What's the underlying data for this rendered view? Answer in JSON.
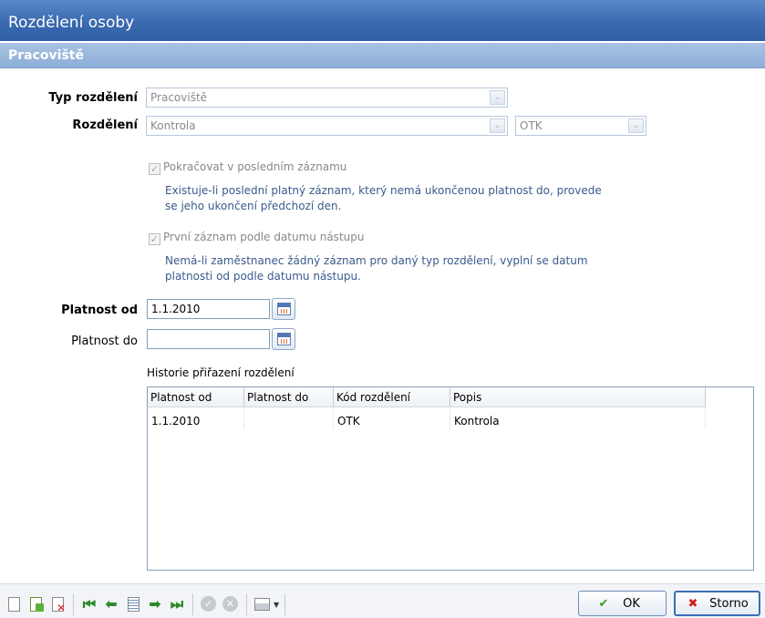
{
  "window": {
    "title": "Rozdělení osoby"
  },
  "section": {
    "title": "Pracoviště"
  },
  "form": {
    "typ_label": "Typ rozdělení",
    "typ_value": "Pracoviště",
    "rozdeleni_label": "Rozdělení",
    "rozdeleni_value": "Kontrola",
    "rozdeleni_code_value": "OTK",
    "pokracovat_label": "Pokračovat v posledním záznamu",
    "pokracovat_checked": true,
    "pokracovat_desc_line1": "Existuje-li poslední platný záznam, který nemá ukončenou platnost do, provede",
    "pokracovat_desc_line2": "se jeho ukončení předchozí den.",
    "prvni_label": "První záznam podle datumu nástupu",
    "prvni_checked": true,
    "prvni_desc_line1": "Nemá-li zaměstnanec žádný záznam pro daný typ rozdělení, vyplní se datum",
    "prvni_desc_line2": "platnosti od podle datumu nástupu.",
    "platnost_od_label": "Platnost od",
    "platnost_od_value": "1.1.2010",
    "platnost_do_label": "Platnost do",
    "platnost_do_value": ""
  },
  "history": {
    "title": "Historie přiřazení rozdělení",
    "columns": [
      "Platnost od",
      "Platnost do",
      "Kód rozdělení",
      "Popis"
    ],
    "rows": [
      [
        "1.1.2010",
        "",
        "OTK",
        "Kontrola"
      ]
    ]
  },
  "toolbar": {
    "icons": [
      "new-icon",
      "copy-icon",
      "delete-icon",
      "first-icon",
      "previous-icon",
      "detail-icon",
      "next-icon",
      "last-icon",
      "confirm-icon",
      "cancel-icon",
      "print-icon"
    ]
  },
  "buttons": {
    "ok_label": "OK",
    "storno_label": "Storno"
  }
}
